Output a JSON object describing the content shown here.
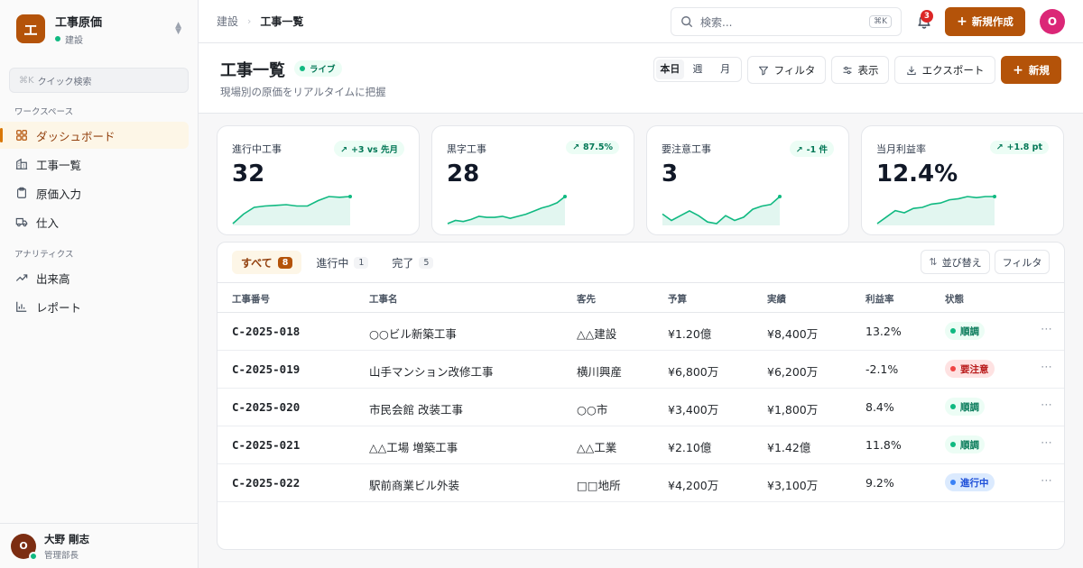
{
  "app": {
    "logo_letter": "エ",
    "name": "工事原価",
    "env": "建設"
  },
  "quick_search": {
    "kbd": "⌘K",
    "placeholder": "クイック検索"
  },
  "sidebar": {
    "sections": [
      {
        "title": "ワークスペース",
        "items": [
          {
            "label": "ダッシュボード",
            "icon": "dashboard-icon",
            "active": true
          },
          {
            "label": "工事一覧",
            "icon": "building-icon"
          },
          {
            "label": "原価入力",
            "icon": "clipboard-icon"
          },
          {
            "label": "仕入",
            "icon": "truck-icon"
          }
        ]
      },
      {
        "title": "アナリティクス",
        "items": [
          {
            "label": "出来高",
            "icon": "trend-icon"
          },
          {
            "label": "レポート",
            "icon": "bar-chart-icon"
          }
        ]
      }
    ]
  },
  "user": {
    "initial": "O",
    "name": "大野 剛志",
    "role": "管理部長"
  },
  "topbar": {
    "breadcrumb": [
      "建設",
      "工事一覧"
    ],
    "search_placeholder": "検索...",
    "search_kbd": "⌘K",
    "notifications": "3",
    "new_button": "新規作成",
    "avatar_initial": "O"
  },
  "page": {
    "title": "工事一覧",
    "live_badge": "ライブ",
    "subtitle": "現場別の原価をリアルタイムに把握",
    "period": [
      "本日",
      "週",
      "月"
    ],
    "buttons": {
      "filter": "フィルタ",
      "view": "表示",
      "export": "エクスポート",
      "new": "新規"
    }
  },
  "kpis": [
    {
      "label": "進行中工事",
      "value": "32",
      "delta": "+3 vs 先月",
      "trend": [
        2,
        9,
        14,
        15,
        15.5,
        16,
        15,
        15,
        19,
        22,
        21.5,
        22
      ]
    },
    {
      "label": "黒字工事",
      "value": "28",
      "delta": "87.5%",
      "trend": [
        5,
        8,
        7,
        9,
        12,
        11,
        11,
        12,
        10,
        12,
        14,
        17,
        20,
        22,
        25,
        31
      ]
    },
    {
      "label": "要注意工事",
      "value": "3",
      "delta": "-1 件",
      "trend": [
        12,
        8,
        11,
        14,
        11,
        7,
        6,
        11,
        8,
        10,
        15,
        17,
        18,
        23
      ]
    },
    {
      "label": "当月利益率",
      "value": "12.4%",
      "delta": "+1.8 pt",
      "trend": [
        2,
        8,
        14,
        12,
        16,
        17,
        20,
        21,
        24,
        25,
        27,
        26,
        27,
        27
      ]
    }
  ],
  "table": {
    "tabs": [
      {
        "label": "すべて",
        "count": "8",
        "active": true
      },
      {
        "label": "進行中",
        "count": "1"
      },
      {
        "label": "完了",
        "count": "5"
      }
    ],
    "sort_button": "並び替え",
    "filter_button": "フィルタ",
    "columns": [
      "工事番号",
      "工事名",
      "客先",
      "予算",
      "実績",
      "利益率",
      "状態"
    ],
    "rows": [
      {
        "id": "C-2025-018",
        "name": "○○ビル新築工事",
        "client": "△△建設",
        "budget": "¥1.20億",
        "actual": "¥8,400万",
        "margin": "13.2%",
        "status": "順調",
        "kind": "ok"
      },
      {
        "id": "C-2025-019",
        "name": "山手マンション改修工事",
        "client": "横川興産",
        "budget": "¥6,800万",
        "actual": "¥6,200万",
        "margin": "-2.1%",
        "status": "要注意",
        "kind": "warn"
      },
      {
        "id": "C-2025-020",
        "name": "市民会館 改装工事",
        "client": "○○市",
        "budget": "¥3,400万",
        "actual": "¥1,800万",
        "margin": "8.4%",
        "status": "順調",
        "kind": "ok"
      },
      {
        "id": "C-2025-021",
        "name": "△△工場 増築工事",
        "client": "△△工業",
        "budget": "¥2.10億",
        "actual": "¥1.42億",
        "margin": "11.8%",
        "status": "順調",
        "kind": "ok"
      },
      {
        "id": "C-2025-022",
        "name": "駅前商業ビル外装",
        "client": "□□地所",
        "budget": "¥4,200万",
        "actual": "¥3,100万",
        "margin": "9.2%",
        "status": "進行中",
        "kind": "progress"
      }
    ]
  },
  "colors": {
    "accent": "#b45309",
    "ok_bg": "#ecfdf5",
    "ok_fg": "#047857",
    "warn_bg": "#fee2e2",
    "warn_fg": "#b91c1c",
    "progress_bg": "#dbeafe",
    "progress_fg": "#1d4ed8",
    "spark": "#10b981"
  }
}
